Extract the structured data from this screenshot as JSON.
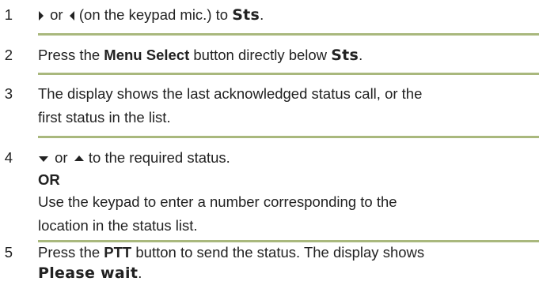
{
  "steps": [
    {
      "number": "1",
      "connector": " or ",
      "text_after_icons": " (on the keypad mic.) to ",
      "display_text": "Sts",
      "end": ".",
      "icons": [
        "right-arrow-icon",
        "left-arrow-icon"
      ]
    },
    {
      "number": "2",
      "text_before": "Press the ",
      "bold_text": "Menu Select",
      "text_middle": " button directly below ",
      "display_text": "Sts",
      "end": "."
    },
    {
      "number": "3",
      "line1": "The display shows the last acknowledged status call, or the",
      "line2": "first status in the list."
    },
    {
      "number": "4",
      "connector": " or ",
      "text_after_icons": " to the required status.",
      "or_label": "OR",
      "line1": "Use the keypad to enter a number corresponding to the",
      "line2": "location in the status list.",
      "icons": [
        "down-arrow-icon",
        "up-arrow-icon"
      ]
    },
    {
      "number": "5",
      "text_before": "Press the ",
      "bold_text": "PTT",
      "text_after": " button to send the status. The display shows",
      "display_text": "Please wait",
      "end": "."
    }
  ],
  "colors": {
    "text": "#222222",
    "divider": "#a9b87d",
    "icon": "#222222"
  }
}
